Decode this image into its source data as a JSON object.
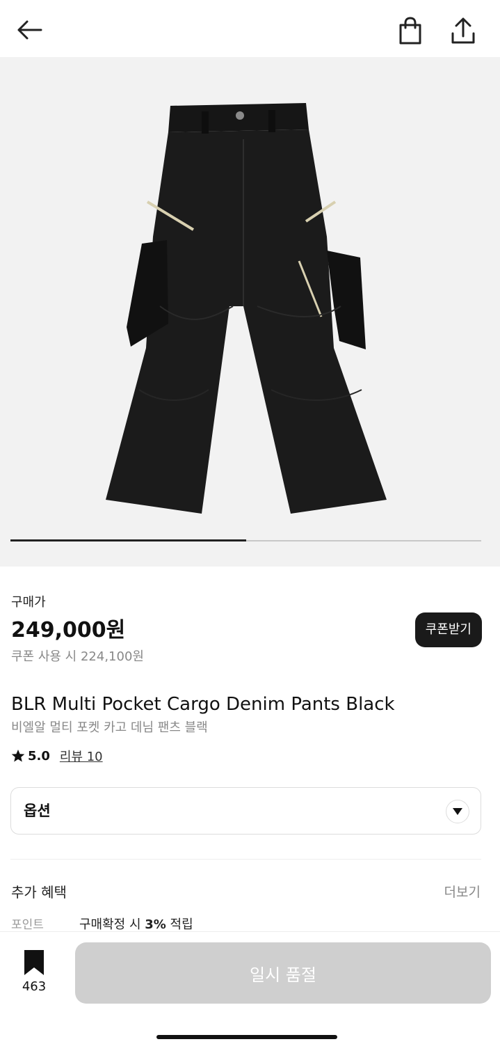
{
  "header": {
    "back_icon": "arrow-left-icon",
    "bag_icon": "shopping-bag-icon",
    "share_icon": "share-icon"
  },
  "gallery": {
    "image_description": "black multi pocket cargo denim pants",
    "progress": 0.5
  },
  "price": {
    "label": "구매가",
    "value": "249,000원",
    "coupon_text": "쿠폰 사용 시 224,100원",
    "coupon_button": "쿠폰받기"
  },
  "product": {
    "name": "BLR Multi Pocket Cargo Denim Pants Black",
    "subname": "비엘알 멀티 포켓 카고 데님 팬츠 블랙",
    "rating": "5.0",
    "reviews": "리뷰 10"
  },
  "option": {
    "label": "옵션"
  },
  "benefits": {
    "title": "추가 혜택",
    "more": "더보기",
    "point_label": "포인트",
    "point_prefix": "구매확정 시 ",
    "point_value": "3%",
    "point_suffix": " 적립"
  },
  "bottom": {
    "wishlist_count": "463",
    "soldout_label": "일시 품절"
  },
  "colors": {
    "accent": "#1a1a1a",
    "disabled": "#cfcfcf",
    "muted": "#888888",
    "gallery_bg": "#f2f2f2"
  }
}
